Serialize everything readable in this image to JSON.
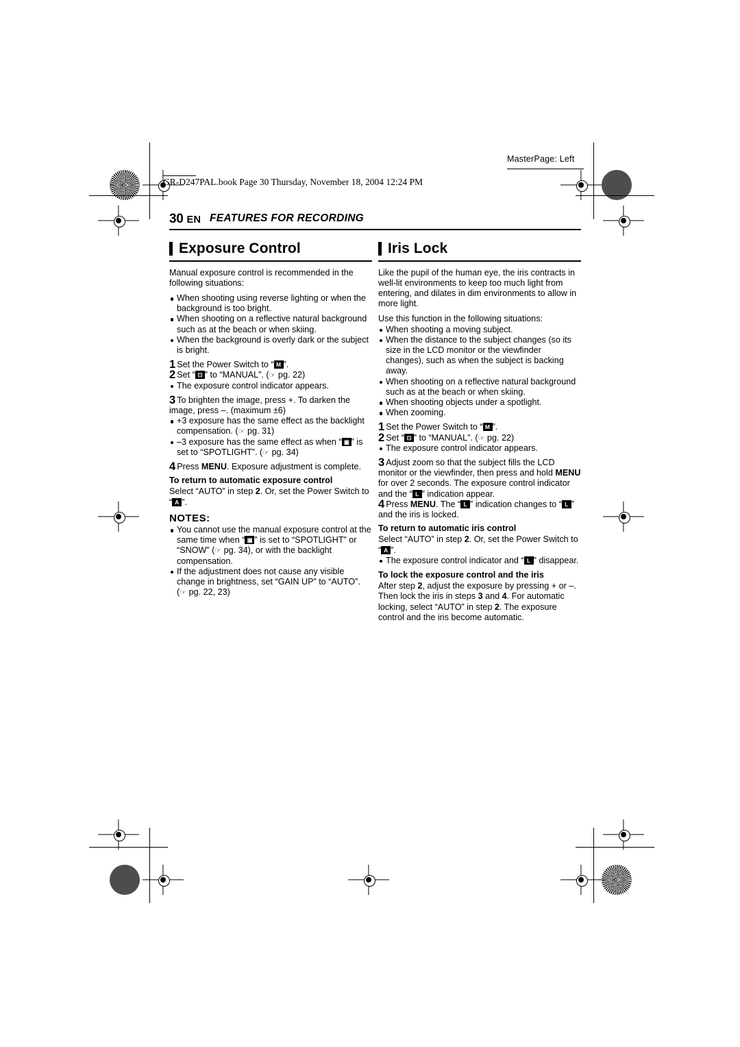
{
  "header": {
    "masterpage": "MasterPage: Left",
    "bookline": "GR-D247PAL.book  Page 30  Thursday, November 18, 2004  12:24 PM",
    "page_number": "30",
    "page_lang": "EN",
    "chapter_title": "FEATURES FOR RECORDING"
  },
  "left_column": {
    "title": "Exposure Control",
    "intro": "Manual exposure control is recommended in the following situations:",
    "bullets": [
      "When shooting using reverse lighting or when the background is too bright.",
      "When shooting on a reflective natural background such as at the beach or when skiing.",
      "When the background is overly dark or the subject is bright."
    ],
    "steps": [
      {
        "num": "1",
        "text_pre": "Set the Power Switch to “",
        "icon": "M",
        "text_post": "”."
      },
      {
        "num": "2",
        "text_pre": "Set “",
        "icon": "exposure",
        "text_post": "” to “MANUAL”. ( pg. 22)"
      }
    ],
    "step2_note": "The exposure control indicator appears.",
    "step3": "To brighten the image, press +. To darken the image, press –. (maximum ±6)",
    "step3_bullets": [
      "+3 exposure has the same effect as the backlight compensation. ( pg. 31)",
      "–3 exposure has the same effect as when “” is set to “SPOTLIGHT”. ( pg. 34)"
    ],
    "step4_bold": "MENU",
    "step4_pre": "Press ",
    "step4_post": ". Exposure adjustment is complete.",
    "return_heading": "To return to automatic exposure control",
    "return_text_a": "Select “AUTO” in step ",
    "return_step": "2",
    "return_text_b": ". Or, set the Power Switch to “",
    "return_icon": "A",
    "return_text_c": "”.",
    "notes_label": "NOTES:",
    "notes": [
      "You cannot use the manual exposure control at the same time when “” is set to “SPOTLIGHT” or “SNOW” ( pg. 34), or with the backlight compensation.",
      "If the adjustment does not cause any visible change in brightness, set “GAIN UP” to “AUTO”. ( pg. 22, 23)"
    ]
  },
  "right_column": {
    "title": "Iris Lock",
    "intro": "Like the pupil of the human eye, the iris contracts in well-lit environments to keep too much light from entering, and dilates in dim environments to allow in more light.",
    "intro2": "Use this function in the following situations:",
    "bullets": [
      "When shooting a moving subject.",
      "When the distance to the subject changes (so its size in the LCD monitor or the viewfinder changes), such as when the subject is backing away.",
      "When shooting on a reflective natural background such as at the beach or when skiing.",
      "When shooting objects under a spotlight.",
      "When zooming."
    ],
    "steps": [
      {
        "num": "1",
        "text_pre": "Set the Power Switch to “",
        "icon": "M",
        "text_post": "”."
      },
      {
        "num": "2",
        "text_pre": "Set “",
        "icon": "exposure",
        "text_post": "” to “MANUAL”. ( pg. 22)"
      }
    ],
    "step2_note": "The exposure control indicator appears.",
    "step3_a": "Adjust zoom so that the subject fills the LCD monitor or the viewfinder, then press and hold ",
    "step3_bold": "MENU",
    "step3_b": " for over 2 seconds. The exposure control indicator and the “",
    "step3_icon": "L",
    "step3_c": "” indication appear.",
    "step4_pre": "Press ",
    "step4_bold": "MENU",
    "step4_mid": ". The “",
    "step4_icon": "L",
    "step4_post": "” indication changes to “",
    "step4_icon2": "L",
    "step4_end": "” and the iris is locked.",
    "return_heading": "To return to automatic iris control",
    "return_text_a": "Select “AUTO” in step ",
    "return_step": "2",
    "return_text_b": ". Or, set the Power Switch to “",
    "return_icon": "A",
    "return_text_c": "”.",
    "return_bullet_a": "The exposure control indicator and “",
    "return_bullet_icon": "L",
    "return_bullet_b": "” disappear.",
    "lock_heading": "To lock the exposure control and the iris",
    "lock_a": "After step ",
    "lock_s2": "2",
    "lock_b": ", adjust the exposure by pressing + or –. Then lock the iris in steps ",
    "lock_s3": "3",
    "lock_c": " and ",
    "lock_s4": "4",
    "lock_d": ". For automatic locking, select “AUTO” in step ",
    "lock_s2b": "2",
    "lock_e": ". The exposure control and the iris become automatic."
  }
}
